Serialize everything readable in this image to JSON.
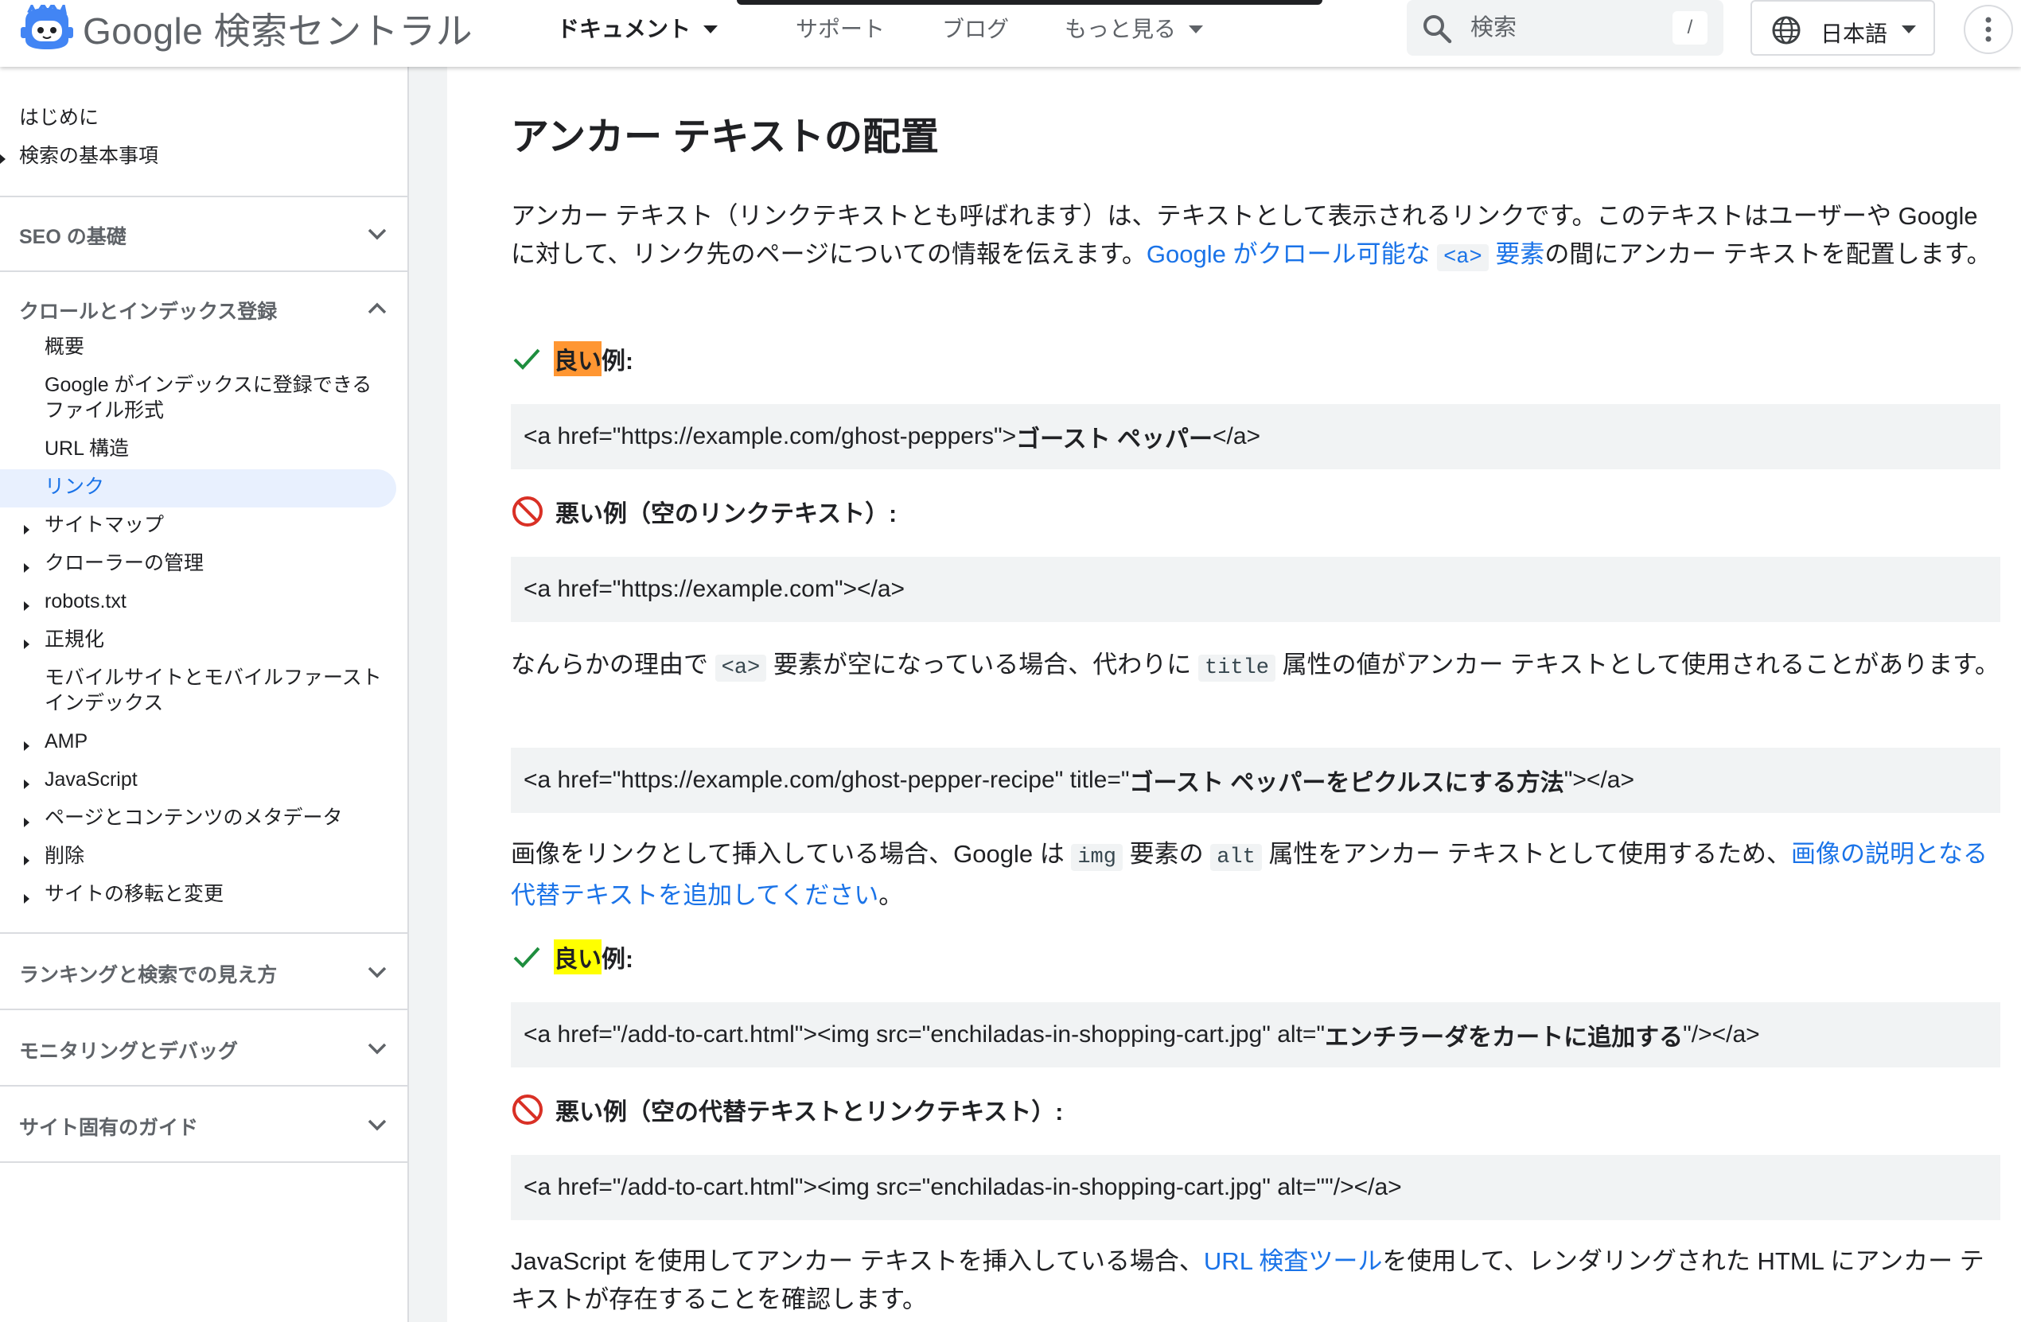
{
  "header": {
    "site_title": "Google 検索セントラル",
    "nav": [
      {
        "label": "ドキュメント",
        "active": true,
        "has_dropdown": true
      },
      {
        "label": "サポート",
        "active": false,
        "has_dropdown": false
      },
      {
        "label": "ブログ",
        "active": false,
        "has_dropdown": false
      },
      {
        "label": "もっと見る",
        "active": false,
        "has_dropdown": true
      }
    ],
    "search": {
      "placeholder": "検索",
      "shortcut": "/"
    },
    "language": "日本語"
  },
  "sidebar": {
    "top_items": [
      "はじめに",
      "検索の基本事項"
    ],
    "sections": [
      {
        "label": "SEO の基礎",
        "expanded": false
      },
      {
        "label": "クロールとインデックス登録",
        "expanded": true
      },
      {
        "label": "ランキングと検索での見え方",
        "expanded": false
      },
      {
        "label": "モニタリングとデバッグ",
        "expanded": false
      },
      {
        "label": "サイト固有のガイド",
        "expanded": false
      }
    ],
    "crawl_items": [
      {
        "label": "概要",
        "expandable": false,
        "active": false
      },
      {
        "label": "Google がインデックスに登録できるファイル形式",
        "expandable": false,
        "active": false
      },
      {
        "label": "URL 構造",
        "expandable": false,
        "active": false
      },
      {
        "label": "リンク",
        "expandable": false,
        "active": true
      },
      {
        "label": "サイトマップ",
        "expandable": true,
        "active": false
      },
      {
        "label": "クローラーの管理",
        "expandable": true,
        "active": false
      },
      {
        "label": "robots.txt",
        "expandable": true,
        "active": false
      },
      {
        "label": "正規化",
        "expandable": true,
        "active": false
      },
      {
        "label": "モバイルサイトとモバイルファースト インデックス",
        "expandable": false,
        "active": false
      },
      {
        "label": "AMP",
        "expandable": true,
        "active": false
      },
      {
        "label": "JavaScript",
        "expandable": true,
        "active": false
      },
      {
        "label": "ページとコンテンツのメタデータ",
        "expandable": true,
        "active": false
      },
      {
        "label": "削除",
        "expandable": true,
        "active": false
      },
      {
        "label": "サイトの移転と変更",
        "expandable": true,
        "active": false
      }
    ]
  },
  "article": {
    "heading": "アンカー テキストの配置",
    "intro": {
      "text1": "アンカー テキスト（リンクテキストとも呼ばれます）は、テキストとして表示されるリンクです。このテキストはユーザーや Google に対して、リンク先のページについての情報を伝えます。",
      "link1": "Google がクロール可能な",
      "code1": "<a>",
      "link2": "要素",
      "text2": "の間にアンカー テキストを配置します。"
    },
    "good_label": {
      "hl": "良い",
      "rest": "例:"
    },
    "bad_empty_link_label": "悪い例（空のリンクテキスト）:",
    "code1": {
      "pre": "<a href=\"https://example.com/ghost-peppers\">",
      "bold": "ゴースト ペッパー",
      "post": "</a>"
    },
    "code2": "<a href=\"https://example.com\"></a>",
    "title_para": {
      "t1": "なんらかの理由で",
      "c1": "<a>",
      "t2": "要素が空になっている場合、代わりに",
      "c2": "title",
      "t3": "属性の値がアンカー テキストとして使用されることがあります。"
    },
    "code3": {
      "pre": "<a href=\"https://example.com/ghost-pepper-recipe\" title=\"",
      "bold": "ゴースト ペッパーをピクルスにする方法",
      "post": "\"></a>"
    },
    "img_para": {
      "t1": "画像をリンクとして挿入している場合、Google は",
      "c1": "img",
      "t2": "要素の",
      "c2": "alt",
      "t3": "属性をアンカー テキストとして使用するため、",
      "link": "画像の説明となる代替テキストを追加してください",
      "t4": "。"
    },
    "code4": {
      "pre": "<a href=\"/add-to-cart.html\"><img src=\"enchiladas-in-shopping-cart.jpg\" alt=\"",
      "bold": "エンチラーダをカートに追加する",
      "post": "\"/></a>"
    },
    "bad_empty_alt_label": "悪い例（空の代替テキストとリンクテキスト）:",
    "code5": "<a href=\"/add-to-cart.html\"><img src=\"enchiladas-in-shopping-cart.jpg\" alt=\"\"/></a>",
    "js_para": {
      "t1": "JavaScript を使用してアンカー テキストを挿入している場合、",
      "link": "URL 検査ツール",
      "t2": "を使用して、レンダリングされた HTML にアンカー テキストが存在することを確認します。"
    }
  },
  "colors": {
    "link": "#1a73e8",
    "check": "#1e8e3e",
    "ban": "#d93025",
    "highlight_orange": "#ff9632",
    "highlight_yellow": "#ffff00",
    "active_nav_bg": "#e8f0fe"
  }
}
